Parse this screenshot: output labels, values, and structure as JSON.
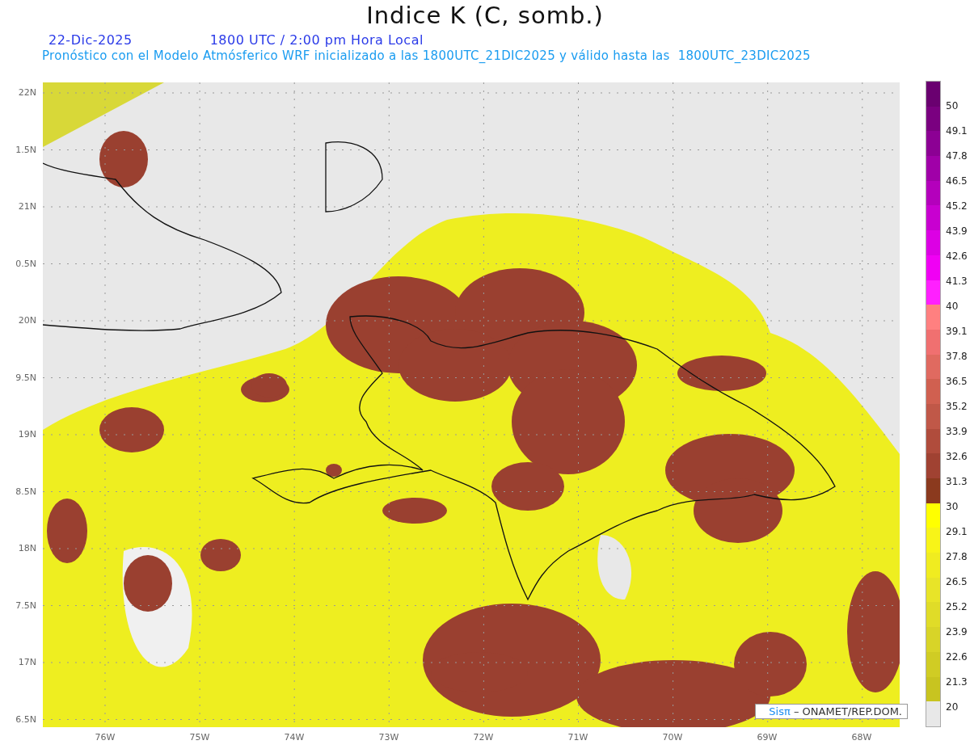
{
  "title": "Indice K (C, somb.)",
  "date": "22-Dic-2025",
  "time": "1800 UTC / 2:00 pm Hora Local",
  "subtitle": "Pronóstico con el Modelo Atmósferico WRF inicializado a las 1800UTC_21DIC2025 y válido hasta las  1800UTC_23DIC2025",
  "y_axis": [
    "22N",
    "1.5N",
    "21N",
    "0.5N",
    "20N",
    "9.5N",
    "19N",
    "8.5N",
    "18N",
    "7.5N",
    "17N",
    "6.5N"
  ],
  "x_axis": [
    "76W",
    "75W",
    "74W",
    "73W",
    "72W",
    "71W",
    "70W",
    "69W",
    "68W"
  ],
  "credit": {
    "brand": "Sisπ",
    "text": "– ONAMET/REP.DOM."
  },
  "legend": [
    {
      "label": "50",
      "color": "#7a0080"
    },
    {
      "label": "49.1",
      "color": "#8c0094"
    },
    {
      "label": "47.8",
      "color": "#a000a8"
    },
    {
      "label": "46.5",
      "color": "#b400bc"
    },
    {
      "label": "45.2",
      "color": "#c800d0"
    },
    {
      "label": "43.9",
      "color": "#dc00e4"
    },
    {
      "label": "42.6",
      "color": "#f000f4"
    },
    {
      "label": "41.3",
      "color": "#ff20ff"
    },
    {
      "label": "40",
      "color": "#ff8080"
    },
    {
      "label": "39.1",
      "color": "#f07070"
    },
    {
      "label": "37.8",
      "color": "#e06a60"
    },
    {
      "label": "36.5",
      "color": "#d06050"
    },
    {
      "label": "35.2",
      "color": "#c05848"
    },
    {
      "label": "33.9",
      "color": "#b04c3c"
    },
    {
      "label": "32.6",
      "color": "#a04232"
    },
    {
      "label": "31.3",
      "color": "#8b3a1e"
    },
    {
      "label": "30",
      "color": "#ffff00"
    },
    {
      "label": "29.1",
      "color": "#f8f418"
    },
    {
      "label": "27.8",
      "color": "#f0ec20"
    },
    {
      "label": "26.5",
      "color": "#e8e428"
    },
    {
      "label": "25.2",
      "color": "#e0dc28"
    },
    {
      "label": "23.9",
      "color": "#d8d428"
    },
    {
      "label": "22.6",
      "color": "#d0cc24"
    },
    {
      "label": "21.3",
      "color": "#c8c420"
    },
    {
      "label": "20",
      "color": "#e8e8e8"
    }
  ]
}
